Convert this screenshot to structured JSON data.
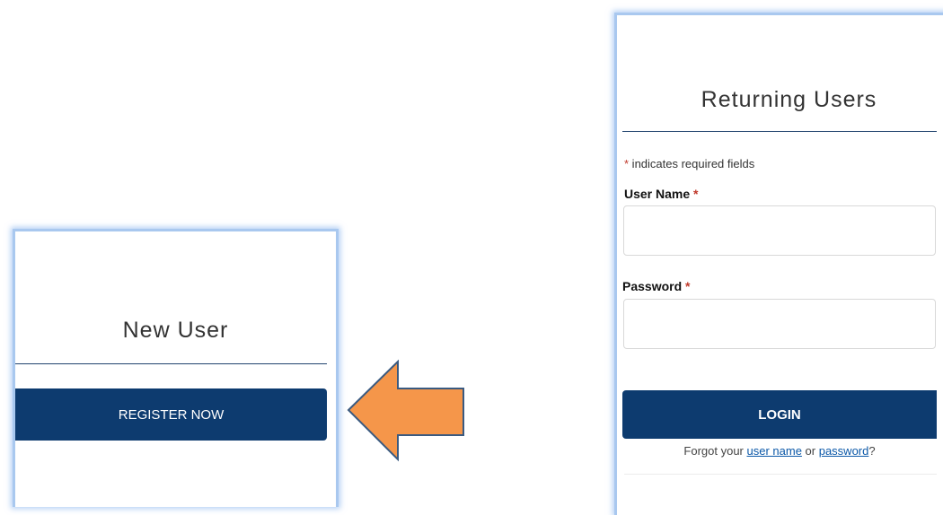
{
  "new_user": {
    "title": "New User",
    "register_label": "REGISTER NOW"
  },
  "returning": {
    "title": "Returning Users",
    "required_note_star": "*",
    "required_note": " indicates required fields",
    "username_label": "User Name",
    "password_label": "Password",
    "required_star": "*",
    "login_label": "LOGIN",
    "forgot_prefix": "Forgot your ",
    "forgot_username_link": "user name",
    "forgot_or": " or ",
    "forgot_password_link": "password",
    "forgot_suffix": "?"
  },
  "annotation": {
    "arrow_color": "#f5964a",
    "arrow_stroke": "#3a5a80",
    "arrow_icon": "left-arrow-icon"
  },
  "colors": {
    "primary": "#0d3b6f",
    "panel_glow": "#a9c8ef",
    "required": "#c0392b",
    "link": "#0b58a8"
  }
}
